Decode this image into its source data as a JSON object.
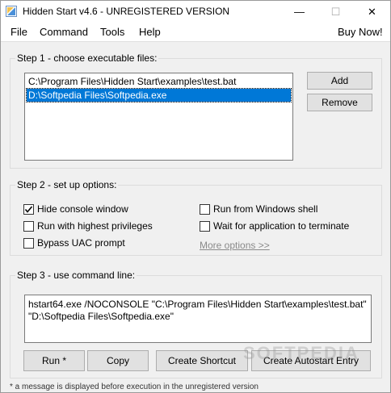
{
  "window": {
    "title": "Hidden Start v4.6 - UNREGISTERED VERSION",
    "minimize_glyph": "—",
    "maximize_glyph": "☐",
    "close_glyph": "✕"
  },
  "menu": {
    "file": "File",
    "command": "Command",
    "tools": "Tools",
    "help": "Help",
    "buy": "Buy Now!"
  },
  "step1": {
    "label": "Step 1 - choose executable files:",
    "files": [
      "C:\\Program Files\\Hidden Start\\examples\\test.bat",
      "D:\\Softpedia Files\\Softpedia.exe"
    ],
    "selected_index": 1,
    "add_label": "Add",
    "remove_label": "Remove"
  },
  "step2": {
    "label": "Step 2 - set up options:",
    "options": [
      {
        "label": "Hide console window",
        "checked": true
      },
      {
        "label": "Run with highest privileges",
        "checked": false
      },
      {
        "label": "Bypass UAC prompt",
        "checked": false
      },
      {
        "label": "Run from Windows shell",
        "checked": false
      },
      {
        "label": "Wait for application to terminate",
        "checked": false
      }
    ],
    "more_options": "More options >>"
  },
  "step3": {
    "label": "Step 3 - use command line:",
    "command": "hstart64.exe /NOCONSOLE \"C:\\Program Files\\Hidden Start\\examples\\test.bat\" \"D:\\Softpedia Files\\Softpedia.exe\"",
    "run_label": "Run *",
    "copy_label": "Copy",
    "shortcut_label": "Create Shortcut",
    "autostart_label": "Create Autostart Entry"
  },
  "footnote": "* a message is displayed before execution in the unregistered version",
  "watermark": "SOFTPEDIA",
  "colors": {
    "selection": "#0078d7",
    "link_disabled": "#8a8a8a"
  }
}
